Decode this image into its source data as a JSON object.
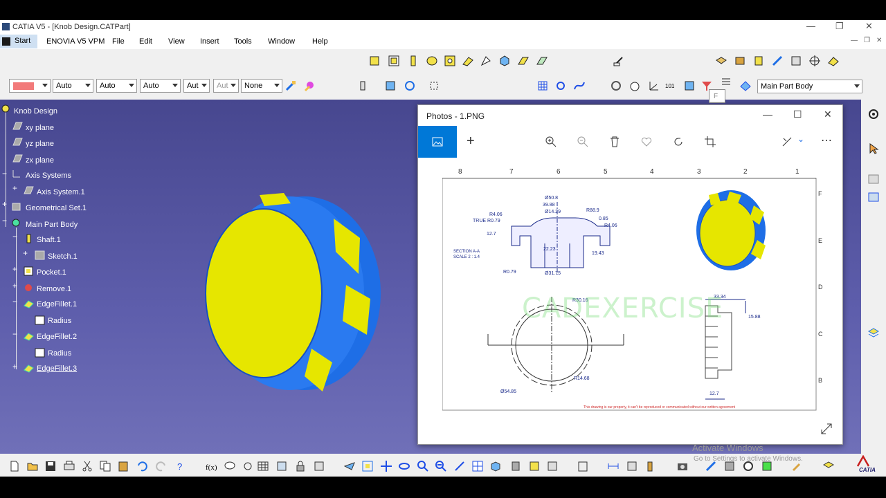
{
  "window": {
    "title": "CATIA V5 - [Knob Design.CATPart]"
  },
  "menu": {
    "items": [
      "Start",
      "ENOVIA V5 VPM",
      "File",
      "Edit",
      "View",
      "Insert",
      "Tools",
      "Window",
      "Help"
    ]
  },
  "graphic_props": {
    "linetype": "Auto",
    "thickness": "Auto",
    "point": "Auto",
    "layer_a": "Aut",
    "layer_b": "Aut",
    "layer_none": "None",
    "fill_color": "#f27a7a"
  },
  "body_combo": {
    "value": "Main Part Body"
  },
  "tooltip": {
    "text": "F"
  },
  "tree": {
    "root": "Knob Design",
    "nodes": [
      {
        "label": "xy plane"
      },
      {
        "label": "yz plane"
      },
      {
        "label": "zx plane"
      },
      {
        "label": "Axis Systems"
      },
      {
        "label": "Axis System.1"
      },
      {
        "label": "Geometrical Set.1"
      },
      {
        "label": "Main Part Body"
      },
      {
        "label": "Shaft.1"
      },
      {
        "label": "Sketch.1"
      },
      {
        "label": "Pocket.1"
      },
      {
        "label": "Remove.1"
      },
      {
        "label": "EdgeFillet.1"
      },
      {
        "label": "Radius"
      },
      {
        "label": "EdgeFillet.2"
      },
      {
        "label": "Radius"
      },
      {
        "label": "EdgeFillet.3"
      }
    ]
  },
  "photos": {
    "title": "Photos - 1.PNG",
    "drawing": {
      "col_labels": [
        "8",
        "7",
        "6",
        "5",
        "4",
        "3",
        "2",
        "1"
      ],
      "row_labels": [
        "F",
        "E",
        "D",
        "C",
        "B"
      ],
      "dims_section": [
        "Ø50.8",
        "39.88",
        "Ø14.29",
        "R88.9",
        "R4.06",
        "TRUE R0.79",
        "0.85",
        "R4.06",
        "12.7",
        "22.23",
        "19.43",
        "R0.79",
        "Ø31.75"
      ],
      "section_label": "SECTION A-A",
      "section_scale": "SCALE 2 : 1.4",
      "dims_front": [
        "R30.16",
        "R14.68",
        "Ø54.85"
      ],
      "dims_side": [
        "33.34",
        "15.88",
        "12.7"
      ],
      "watermark": "CADEXERCISE",
      "note": "This drawing is our property, it can't be reproduced or communicated without our written agreement"
    }
  },
  "activate": {
    "line1": "Activate Windows",
    "line2": "Go to Settings to activate Windows."
  },
  "catia_logo": "CATIA",
  "colors": {
    "knob_blue": "#1e6ee6",
    "knob_yellow": "#e6e600",
    "viewport_top": "#47478f",
    "photos_accent": "#0078d7"
  }
}
